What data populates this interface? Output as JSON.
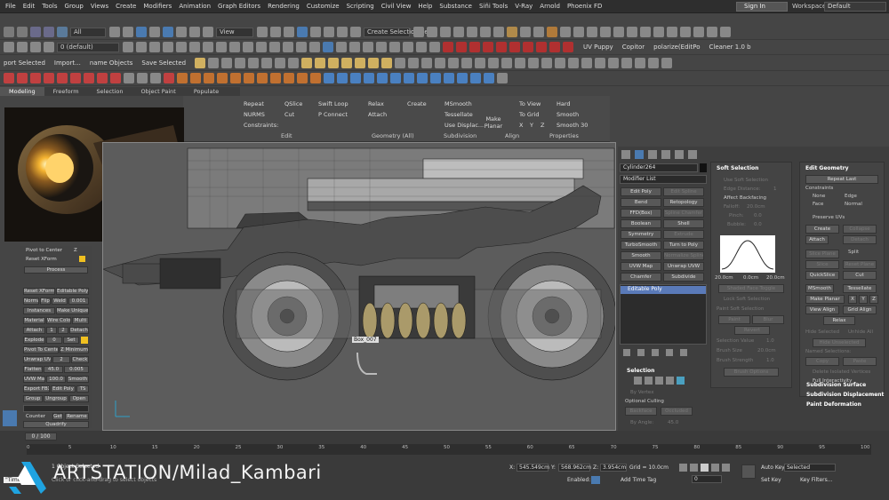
{
  "menu": [
    "File",
    "Edit",
    "Tools",
    "Group",
    "Views",
    "Create",
    "Modifiers",
    "Animation",
    "Graph Editors",
    "Rendering",
    "Customize",
    "Scripting",
    "Civil View",
    "Help",
    "Substance",
    "Siñi Tools",
    "V-Ray",
    "Arnold",
    "Phoenix FD"
  ],
  "signin": "Sign In",
  "workspaces_label": "Workspaces:",
  "workspaces_value": "Default",
  "toolbar1": {
    "all_dropdown": "All",
    "view_dropdown": "View",
    "selection_set": "Create Selection Se"
  },
  "toolbar2": {
    "layer_dropdown": "0 (default)",
    "uv_puppy": "UV Puppy",
    "copitor": "Copitor",
    "cleaner": "Cleaner 1.0 b",
    "polarize": "polarize(EditPo"
  },
  "toolbar3": {
    "port_selected": "port Selected",
    "import": "Import...",
    "name_objects": "name Objects",
    "save_selected": "Save Selected"
  },
  "ribbon_tabs": [
    "Modeling",
    "Freeform",
    "Selection",
    "Object Paint",
    "Populate"
  ],
  "ribbon": {
    "col1": [
      "Repeat",
      "NURMS",
      "Constraints:"
    ],
    "col2": [
      "QSlice",
      "Cut"
    ],
    "col3": [
      "Swift Loop",
      "P Connect"
    ],
    "col4": [
      "Relax",
      "Attach"
    ],
    "create": "Create",
    "col5": [
      "MSmooth",
      "Tessellate",
      "Use Displac..."
    ],
    "make_planar": "Make Planar",
    "col6": [
      "To View",
      "To Grid"
    ],
    "xyz": [
      "X",
      "Y",
      "Z"
    ],
    "col7": [
      "Hard",
      "Smooth",
      "Smooth 30"
    ],
    "sections": [
      "Edit",
      "Geometry (All)",
      "Subdivision",
      "Align",
      "Properties"
    ]
  },
  "left_panel": {
    "pivot_to_center": "Pivot to Center",
    "z": "Z",
    "reset_xform_chk": "Reset XForm",
    "process": "Process",
    "buttons": [
      [
        "Reset XForm",
        "Editable Poly"
      ],
      [
        "Normal",
        "Flip",
        "Weld",
        "0.001"
      ],
      [
        "Instances",
        "Make Unique"
      ],
      [
        "Material",
        "Wire Color",
        "Multi"
      ],
      [
        "Attach",
        "1",
        "2",
        "Detach"
      ],
      [
        "Explode",
        "0",
        "Set"
      ],
      [
        "Pivot To Center",
        "Z Minimum"
      ],
      [
        "Unwrap UVW",
        "2",
        "Check"
      ],
      [
        "Flatten",
        "45.0",
        "0.005"
      ],
      [
        "UVW Map",
        "100.0",
        "Smooth"
      ],
      [
        "Export FBX",
        "Edit Poly",
        "TS"
      ],
      [
        "Group",
        "Ungroup",
        "Open"
      ]
    ],
    "counter": "Counter",
    "get": "Get",
    "rename": "Rename",
    "quadrify": "Quadrify"
  },
  "viewport": {
    "label": "Box_007"
  },
  "modifier_panel": {
    "object_name": "Cylinder264",
    "modifier_list": "Modifier List",
    "buttons": [
      [
        "Edit Poly",
        "Edit Spline"
      ],
      [
        "Bend",
        "Retopology"
      ],
      [
        "FFD(Box)",
        "Spline Chamfer"
      ],
      [
        "Boolean",
        "Shell"
      ],
      [
        "Symmetry",
        "Extrude"
      ],
      [
        "TurboSmooth",
        "Turn to Poly"
      ],
      [
        "Smooth",
        "Normalize Spline"
      ],
      [
        "UVW Map",
        "Unwrap UVW"
      ],
      [
        "Chamfer",
        "Subdivide"
      ]
    ],
    "stack_item": "Editable Poly",
    "selection_head": "Selection",
    "by_vertex": "By Vertex",
    "optional_culling": "Optional Culling",
    "backface": "Backface",
    "occluded": "Occluded",
    "by_angle": "By Angle:",
    "by_angle_val": "45.0"
  },
  "soft_selection": {
    "head": "Soft Selection",
    "use_soft": "Use Soft Selection",
    "edge_distance": "Edge Distance:",
    "edge_val": "1",
    "affect_backfacing": "Affect Backfacing",
    "falloff": "Falloff:",
    "falloff_val": "20.0cm",
    "pinch": "Pinch:",
    "pinch_val": "0.0",
    "bubble": "Bubble:",
    "bubble_val": "0.0",
    "curve_left": "20.0cm",
    "curve_mid": "0.0cm",
    "curve_right": "20.0cm",
    "shaded_face": "Shaded Face Toggle",
    "lock": "Lock Soft Selection",
    "paint_head": "Paint Soft Selection",
    "paint": "Paint",
    "blur": "Blur",
    "revert": "Revert",
    "sel_value": "Selection Value",
    "sel_value_v": "1.0",
    "brush_size": "Brush Size",
    "brush_size_v": "20.0cm",
    "brush_strength": "Brush Strength",
    "brush_strength_v": "1.0",
    "brush_options": "Brush Options"
  },
  "edit_geometry": {
    "head": "Edit Geometry",
    "repeat_last": "Repeat Last",
    "constraints": "Constraints",
    "none": "None",
    "edge": "Edge",
    "face": "Face",
    "normal": "Normal",
    "preserve_uvs": "Preserve UVs",
    "create": "Create",
    "collapse": "Collapse",
    "attach": "Attach",
    "detach": "Detach",
    "slice_plane": "Slice Plane",
    "split": "Split",
    "slice": "Slice",
    "reset_plane": "Reset Plane",
    "quickslice": "QuickSlice",
    "cut": "Cut",
    "msmooth": "MSmooth",
    "tessellate": "Tessellate",
    "make_planar": "Make Planar",
    "x": "X",
    "y": "Y",
    "z": "Z",
    "view_align": "View Align",
    "grid_align": "Grid Align",
    "relax": "Relax",
    "hide_selected": "Hide Selected",
    "unhide_all": "Unhide All",
    "hide_unselected": "Hide Unselected",
    "named_selections": "Named Selections:",
    "copy": "Copy",
    "paste": "Paste",
    "delete_isolated": "Delete Isolated Vertices",
    "full_interactivity": "Full Interactivity",
    "subdivision_surface": "Subdivision Surface",
    "subdivision_displacement": "Subdivision Displacement",
    "paint_deformation": "Paint Deformation"
  },
  "timeline": {
    "frame": "0 / 100",
    "ticks": [
      "0",
      "5",
      "10",
      "15",
      "20",
      "25",
      "30",
      "35",
      "40",
      "45",
      "50",
      "55",
      "60",
      "65",
      "70",
      "75",
      "80",
      "85",
      "90",
      "95",
      "100"
    ]
  },
  "status": {
    "objects": "1 Object Selected",
    "hint": "Click or click-and-drag to select objects",
    "x_label": "X:",
    "x": "545.549cm",
    "y_label": "Y:",
    "y": "568.962cm",
    "z_label": "Z:",
    "z": "3.954cm",
    "grid": "Grid = 10.0cm",
    "enabled": "Enabled:",
    "add_time_tag": "Add Time Tag",
    "auto_key": "Auto Key",
    "set_key": "Set Key",
    "selected": "Selected",
    "key_filters": "Key Filters...",
    "frame_field": "0",
    "script": "\"Time\" tx"
  },
  "watermark": {
    "brand": "ARTSTATION",
    "handle": "/Milad_Kambari"
  }
}
